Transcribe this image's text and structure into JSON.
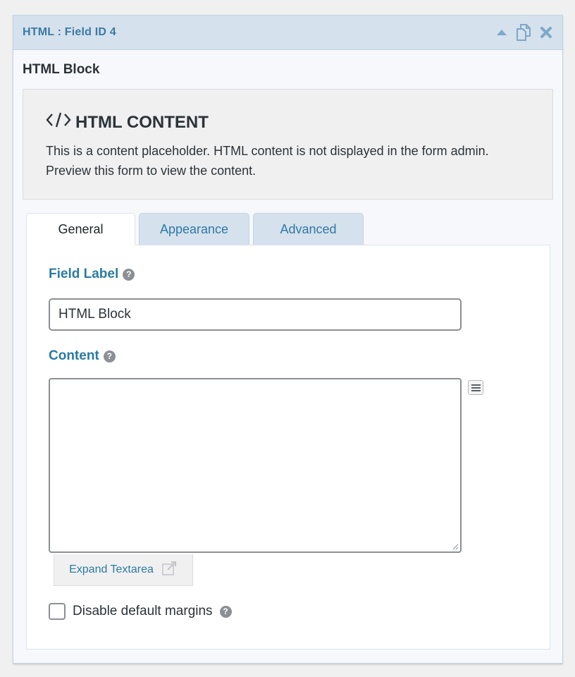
{
  "header": {
    "title": "HTML : Field ID 4",
    "icons": [
      "collapse-arrow-icon",
      "duplicate-icon",
      "delete-icon"
    ]
  },
  "block_title": "HTML Block",
  "placeholder": {
    "heading": "HTML CONTENT",
    "icon": "code-icon",
    "text": "This is a content placeholder. HTML content is not displayed in the form admin. Preview this form to view the content."
  },
  "tabs": [
    {
      "label": "General",
      "active": true
    },
    {
      "label": "Appearance",
      "active": false
    },
    {
      "label": "Advanced",
      "active": false
    }
  ],
  "general": {
    "field_label": {
      "label": "Field Label",
      "value": "HTML Block"
    },
    "content": {
      "label": "Content",
      "value": ""
    },
    "expand_button": "Expand Textarea",
    "disable_margins": {
      "label": "Disable default margins",
      "checked": false
    }
  },
  "colors": {
    "accent": "#2a7ba2",
    "header_bg": "#d5e1ec",
    "title_blue": "#3b7aa6"
  }
}
